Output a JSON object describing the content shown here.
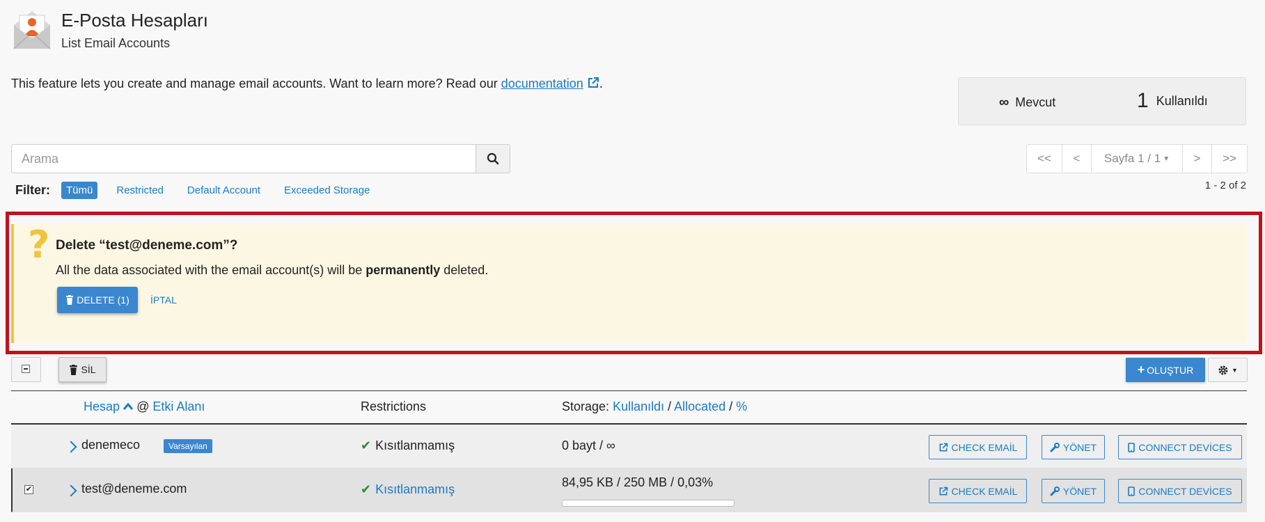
{
  "header": {
    "title": "E-Posta Hesapları",
    "subtitle": "List Email Accounts"
  },
  "intro": {
    "text": "This feature lets you create and manage email accounts. Want to learn more? Read our ",
    "link": "documentation",
    "suffix": "."
  },
  "stats": {
    "available_symbol": "∞",
    "available_label": "Mevcut",
    "used_value": "1",
    "used_label": "Kullanıldı"
  },
  "search": {
    "placeholder": "Arama"
  },
  "filter": {
    "label": "Filter:",
    "chips": [
      "Tümü",
      "Restricted",
      "Default Account",
      "Exceeded Storage"
    ],
    "active": "Tümü"
  },
  "pagination": {
    "first": "<<",
    "prev": "<",
    "page": "Sayfa 1 / 1",
    "next": ">",
    "last": ">>",
    "info": "1 - 2 of 2"
  },
  "alert": {
    "title": "Delete “test@deneme.com”?",
    "text_before": "All the data associated with the email account(s) will be ",
    "text_bold": "permanently",
    "text_after": " deleted.",
    "delete_label": "DELETE (1)",
    "cancel_label": "İPTAL"
  },
  "toolbar": {
    "delete_label": "SİL",
    "create_label": "OLUŞTUR"
  },
  "table": {
    "headers": {
      "account": "Hesap",
      "at": "@",
      "domain": "Etki Alanı",
      "restrictions": "Restrictions",
      "storage_prefix": "Storage:",
      "used": "Kullanıldı",
      "sep1": "/",
      "allocated": "Allocated",
      "sep2": "/",
      "percent": "%"
    },
    "rows": [
      {
        "account": "denemeco",
        "badge": "Varsayılan",
        "restriction": "Kısıtlanmamış",
        "storage": "0 bayt / ∞",
        "checked": false,
        "usage_fraction": 0
      },
      {
        "account": "test@deneme.com",
        "badge": "",
        "restriction": "Kısıtlanmamış",
        "storage": "84,95 KB / 250 MB / 0,03%",
        "checked": true,
        "usage_fraction": 0.0003
      }
    ],
    "actions": {
      "check_email": "CHECK EMAİL",
      "manage": "YÖNET",
      "connect": "CONNECT DEVİCES"
    }
  },
  "colors": {
    "accent": "#3a87cf",
    "link": "#1a7bc4",
    "alert_bg": "#fcf7e3",
    "alert_border": "#f0c43c",
    "highlight": "#c0121c",
    "success": "#2e8a3a"
  },
  "icons": {
    "app": "email-envelope-user-icon",
    "external": "external-link-icon",
    "search": "search-icon",
    "question": "question-icon",
    "trash": "trash-icon",
    "plus": "plus-icon",
    "gear": "gear-icon",
    "chevron": "chevron-right-icon",
    "check": "check-icon",
    "wrench": "wrench-icon",
    "mobile": "mobile-icon"
  }
}
